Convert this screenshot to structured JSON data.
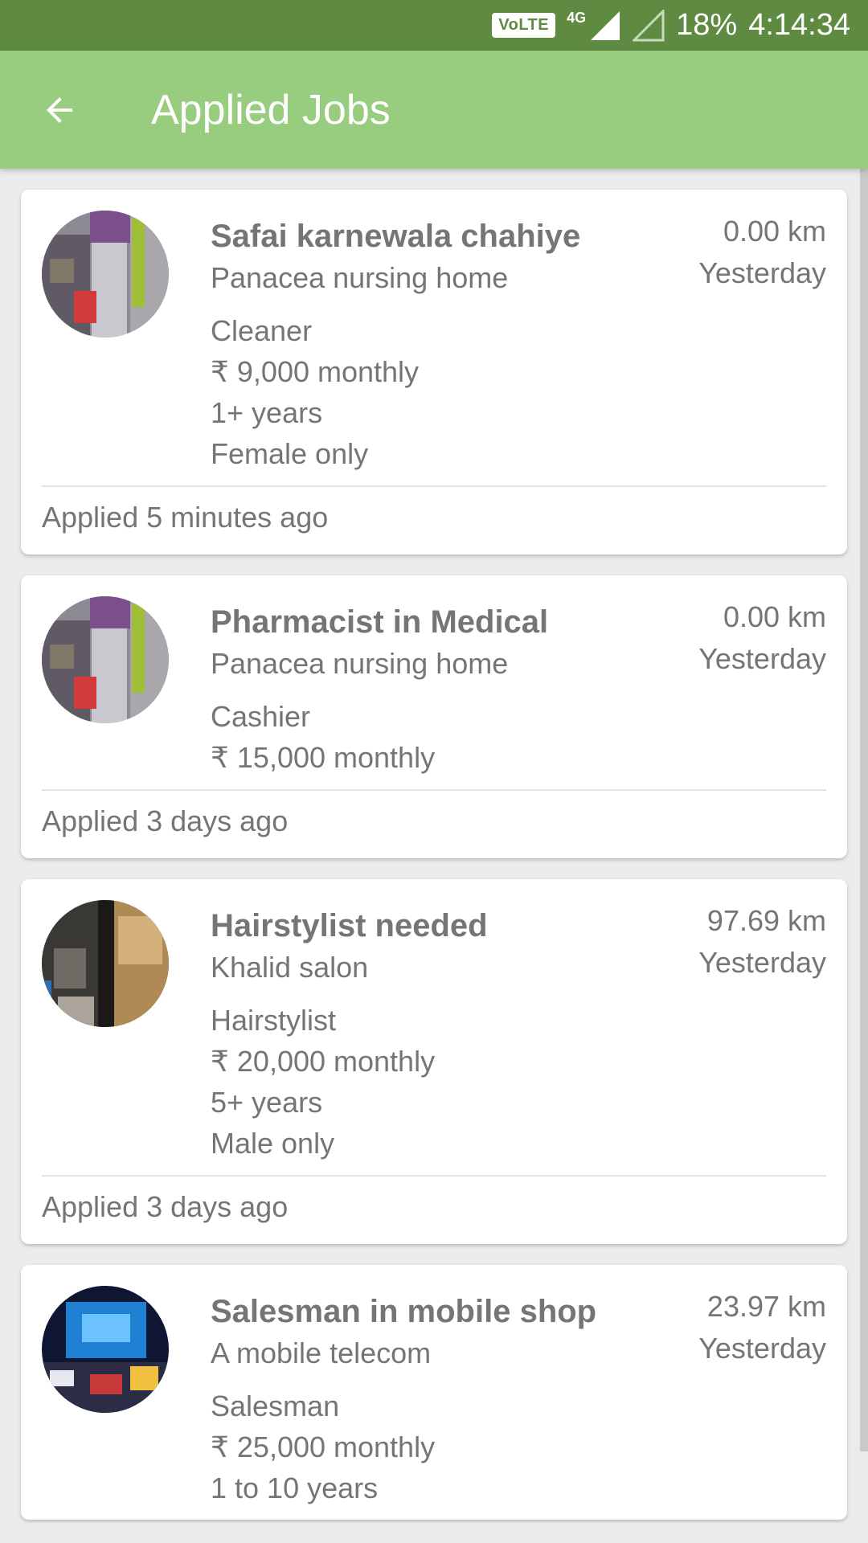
{
  "status_bar": {
    "volte": "VoLTE",
    "network": "4G",
    "battery": "18%",
    "time": "4:14:34"
  },
  "app_bar": {
    "back_icon": "arrow-back-icon",
    "title": "Applied Jobs"
  },
  "colors": {
    "status_bar": "#5e8b41",
    "app_bar": "#98cc7e",
    "text_secondary": "#757575"
  },
  "jobs": [
    {
      "title": "Safai karnewala chahiye",
      "company": "Panacea nursing home",
      "distance": "0.00 km",
      "posted": "Yesterday",
      "details": [
        "Cleaner",
        "₹ 9,000 monthly",
        "1+ years",
        "Female only"
      ],
      "applied": "Applied 5 minutes ago"
    },
    {
      "title": "Pharmacist in Medical",
      "company": "Panacea nursing home",
      "distance": "0.00 km",
      "posted": "Yesterday",
      "details": [
        "Cashier",
        "₹ 15,000 monthly"
      ],
      "applied": "Applied 3 days ago"
    },
    {
      "title": "Hairstylist needed",
      "company": "Khalid salon",
      "distance": "97.69 km",
      "posted": "Yesterday",
      "details": [
        "Hairstylist",
        "₹ 20,000 monthly",
        "5+ years",
        "Male only"
      ],
      "applied": "Applied 3 days ago"
    },
    {
      "title": "Salesman in mobile shop",
      "company": "A mobile telecom",
      "distance": "23.97 km",
      "posted": "Yesterday",
      "details": [
        "Salesman",
        "₹ 25,000 monthly",
        "1 to 10 years"
      ],
      "applied": ""
    }
  ]
}
